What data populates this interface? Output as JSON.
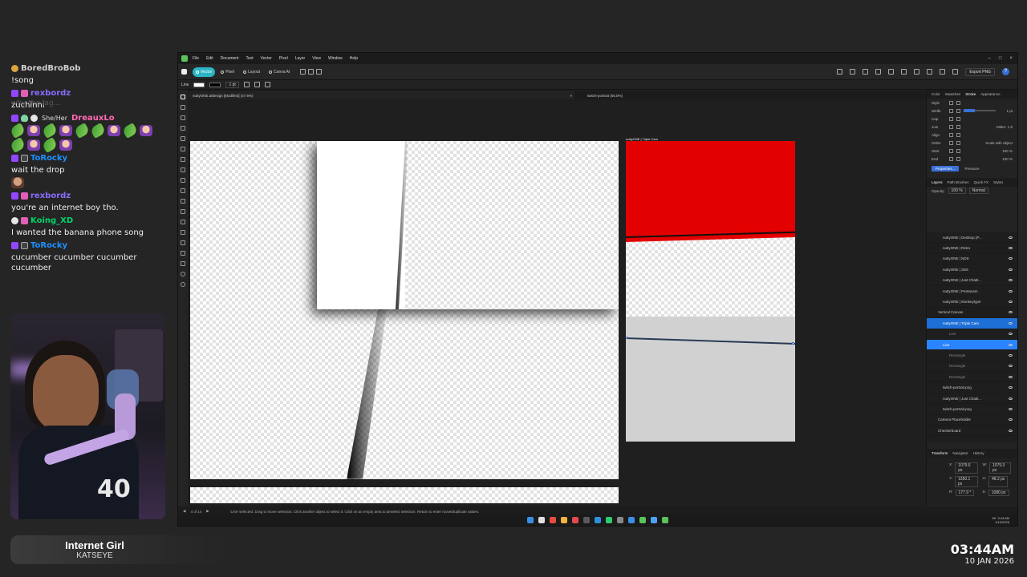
{
  "chat": {
    "faded_prev": "why the lag...",
    "messages": [
      {
        "user": "BoredBroBob",
        "color": "#d0d0d0",
        "text": "!song",
        "badges": [
          "gold"
        ]
      },
      {
        "user": "rexbordz",
        "color": "#8a6cff",
        "text": "zuchinni",
        "badges": [
          "purple",
          "pink"
        ]
      },
      {
        "user": "DreauxLo",
        "color": "#ff69b4",
        "pronoun": "She/Her",
        "text": "",
        "badges": [
          "purple",
          "shield",
          "white"
        ],
        "emotes": [
          "cuke",
          "face",
          "cuke",
          "face",
          "cuke",
          "cuke",
          "face",
          "cuke",
          "face",
          "cuke",
          "face",
          "cuke",
          "face"
        ]
      },
      {
        "user": "ToRocky",
        "color": "#1e90ff",
        "text": "wait the drop",
        "badges": [
          "purple",
          "box"
        ],
        "emotes_after": [
          "pic"
        ]
      },
      {
        "user": "rexbordz",
        "color": "#8a6cff",
        "text": "you're an internet boy tho.",
        "badges": [
          "purple",
          "pink"
        ]
      },
      {
        "user": "Koing_XD",
        "color": "#00d26a",
        "text": "I wanted the banana phone song",
        "badges": [
          "white",
          "pink"
        ]
      },
      {
        "user": "ToRocky",
        "color": "#1e90ff",
        "text": "cucumber cucumber cucumber cucumber",
        "badges": [
          "purple",
          "box"
        ]
      }
    ]
  },
  "now_playing": {
    "song": "Internet Girl",
    "artist": "KATSEYE"
  },
  "clock": {
    "time": "03:44AM",
    "date": "10 JAN 2026"
  },
  "app": {
    "menu": [
      "File",
      "Edit",
      "Document",
      "Text",
      "Vector",
      "Pixel",
      "Layer",
      "View",
      "Window",
      "Help"
    ],
    "window_controls": [
      "–",
      "□",
      "×"
    ],
    "personas": [
      {
        "label": "Vector",
        "active": true
      },
      {
        "label": "Pixel",
        "active": false
      },
      {
        "label": "Layout",
        "active": false
      },
      {
        "label": "Canva AI",
        "active": false
      }
    ],
    "export_label": "Export PNG",
    "help_label": "?",
    "context": {
      "label": "Line",
      "stroke_width": "1 pt"
    },
    "tabs": [
      {
        "label": "nuttyONE.afdesign [Modified] (47.6%)",
        "active": true
      },
      {
        "label": "twitch-portrait (56.0%)",
        "active": false
      }
    ],
    "artboard2_label": "nuttyONE | Triple Cam",
    "right_panel": {
      "top_tabs": [
        "Color",
        "Swatches",
        "Stroke",
        "Appearance"
      ],
      "active_top_tab": "Stroke",
      "stroke_rows": [
        {
          "label": "Style",
          "value": ""
        },
        {
          "label": "Width",
          "value": "1 pt"
        },
        {
          "label": "Cap",
          "value": ""
        },
        {
          "label": "Join",
          "value": "Mitter: 1.5"
        },
        {
          "label": "Align",
          "value": ""
        },
        {
          "label": "Order",
          "value": "Scale with object"
        },
        {
          "label": "Start",
          "value": "100 %"
        },
        {
          "label": "End",
          "value": "100 %"
        }
      ],
      "properties_label": "Properties...",
      "pressure_label": "Pressure",
      "layer_tabs": [
        "Layers",
        "Path Brushes",
        "Quick FX",
        "Styles"
      ],
      "opacity_label": "Opacity:",
      "opacity_value": "100 %",
      "blend_mode": "Normal",
      "layers": [
        {
          "name": "nuttyONE | Desktop (P...",
          "kind": "normal"
        },
        {
          "name": "nuttyONE | Retro",
          "kind": "normal"
        },
        {
          "name": "nuttyONE | NDS",
          "kind": "normal"
        },
        {
          "name": "nuttyONE | 3DS",
          "kind": "normal"
        },
        {
          "name": "nuttyONE | Just Chatti...",
          "kind": "normal"
        },
        {
          "name": "nuttyONE | Pentacam",
          "kind": "normal"
        },
        {
          "name": "nuttyONE | Monkeytype",
          "kind": "normal"
        },
        {
          "name": "Vertical Canvas",
          "kind": "group"
        },
        {
          "name": "nuttyONE | Triple Cam",
          "kind": "sel"
        },
        {
          "name": "Line",
          "kind": "child"
        },
        {
          "name": "Line",
          "kind": "selchild"
        },
        {
          "name": "Rectangle",
          "kind": "child"
        },
        {
          "name": "Rectangle",
          "kind": "child"
        },
        {
          "name": "Rectangle",
          "kind": "child"
        },
        {
          "name": "twitch-portrait.png",
          "kind": "normal"
        },
        {
          "name": "nuttyONE | Just Chatti...",
          "kind": "normal"
        },
        {
          "name": "twitch-portrait.png",
          "kind": "normal"
        },
        {
          "name": "Camera Placeholder",
          "kind": "group"
        },
        {
          "name": "Checkerboard",
          "kind": "group"
        }
      ],
      "transform_tabs": [
        "Transform",
        "Navigator",
        "History"
      ],
      "transform": {
        "x": "1079.6 px",
        "y": "1350.1 px",
        "w": "1079.3 px",
        "h": "48.2 px",
        "r": "177.9 °",
        "s": "1080 px"
      }
    },
    "status": {
      "page": "4 of 14",
      "hint": "'Line' selected. Drag to move selection. Click another object to select it. Click on an empty area to deselect selection. Return to enter move/duplicate values."
    },
    "tray": {
      "time": "3:44 AM",
      "date": "1/10/2026",
      "temp": "69"
    },
    "taskbar_colors": [
      "#3a8ee6",
      "#e0e0e0",
      "#e84c3d",
      "#f3b33d",
      "#e34b4b",
      "#5a5a5a",
      "#2f8fdd",
      "#2ecc71",
      "#888",
      "#3a8ee6",
      "#5cc25a",
      "#4ba3f0",
      "#5cc25a"
    ]
  }
}
